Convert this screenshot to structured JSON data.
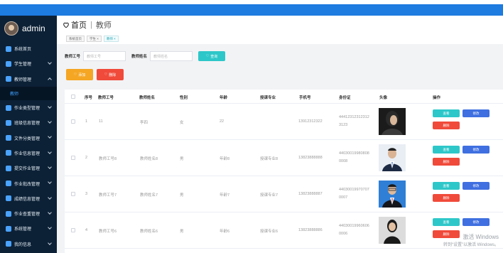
{
  "app": {
    "brand": "admin"
  },
  "sidebar": {
    "items": [
      {
        "label": "系统首页",
        "icon": "home-icon"
      },
      {
        "label": "学生管理",
        "icon": "user-icon"
      },
      {
        "label": "教师管理",
        "icon": "teacher-icon",
        "open": true
      },
      {
        "label": "作业类型管理",
        "icon": "grid-icon"
      },
      {
        "label": "班级信息管理",
        "icon": "grid-icon"
      },
      {
        "label": "文件分类管理",
        "icon": "person-icon"
      },
      {
        "label": "作业信息管理",
        "icon": "grid-icon"
      },
      {
        "label": "提交作业管理",
        "icon": "grid-icon"
      },
      {
        "label": "作业批改管理",
        "icon": "grid-icon"
      },
      {
        "label": "成绩信息管理",
        "icon": "grid-icon"
      },
      {
        "label": "作业查重管理",
        "icon": "grid-icon"
      },
      {
        "label": "系统管理",
        "icon": "grid-icon"
      },
      {
        "label": "我的信息",
        "icon": "grid-icon"
      }
    ],
    "submenu": "教师"
  },
  "header": {
    "home": "首页",
    "current": "教师"
  },
  "tags": [
    "系统首页",
    "学生 ×",
    "教师 ×"
  ],
  "search": {
    "id_label": "教师工号",
    "id_placeholder": "教师工号",
    "name_label": "教师姓名",
    "name_placeholder": "教师姓名",
    "search_button": "查询"
  },
  "actions": {
    "add": "添加",
    "delete": "删除"
  },
  "table": {
    "columns": [
      "序号",
      "教师工号",
      "教师姓名",
      "性别",
      "年龄",
      "授课专业",
      "手机号",
      "身份证",
      "头像",
      "操作"
    ],
    "rows": [
      {
        "index": "1",
        "id": "11",
        "name": "李四",
        "gender": "女",
        "age": "22",
        "major": "",
        "phone": "13912312322",
        "idcard1": "44412312312312",
        "idcard2": "3123"
      },
      {
        "index": "2",
        "id": "教师工号8",
        "name": "教师姓名8",
        "gender": "男",
        "age": "年龄8",
        "major": "授课专业8",
        "phone": "13823888888",
        "idcard1": "44030019980808",
        "idcard2": "0008"
      },
      {
        "index": "3",
        "id": "教师工号7",
        "name": "教师姓名7",
        "gender": "男",
        "age": "年龄7",
        "major": "授课专业7",
        "phone": "13823888887",
        "idcard1": "44030019970707",
        "idcard2": "0007"
      },
      {
        "index": "4",
        "id": "教师工号6",
        "name": "教师姓名6",
        "gender": "男",
        "age": "年龄6",
        "major": "授课专业6",
        "phone": "13823888886",
        "idcard1": "44030019960606",
        "idcard2": "0006"
      }
    ],
    "row_buttons": {
      "view": "查看",
      "edit": "修改",
      "delete": "删除"
    }
  },
  "watermark": {
    "line1": "激活 Windows",
    "line2": "转到“设置”以激活 Windows。"
  }
}
